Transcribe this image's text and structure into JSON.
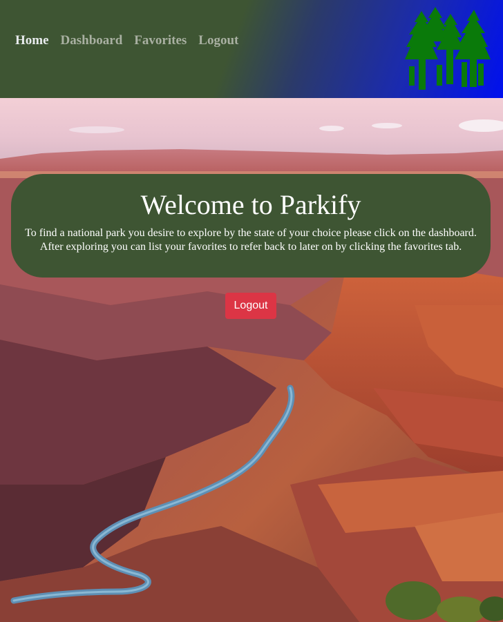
{
  "nav": {
    "items": [
      {
        "label": "Home",
        "active": true
      },
      {
        "label": "Dashboard",
        "active": false
      },
      {
        "label": "Favorites",
        "active": false
      },
      {
        "label": "Logout",
        "active": false
      }
    ]
  },
  "logo": {
    "icon": "pine-trees-icon",
    "color": "#0a7a0a"
  },
  "hero": {
    "image": "grand-canyon-landscape"
  },
  "welcome": {
    "title": "Welcome to Parkify",
    "line1": "To find a national park you desire to explore by the state of your choice please click on the dashboard.",
    "line2": "After exploring you can list your favorites to refer back to later on by clicking the favorites tab."
  },
  "logout_button": {
    "label": "Logout"
  },
  "colors": {
    "header_green": "#3e5533",
    "header_blue": "#0010ee",
    "card_green": "#3e5533",
    "button_red": "#dc3545"
  }
}
